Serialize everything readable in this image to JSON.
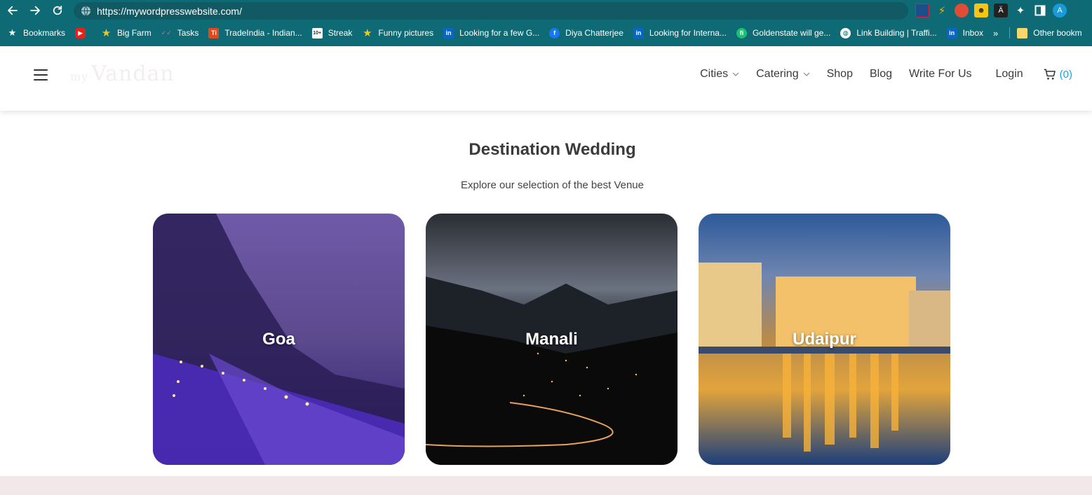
{
  "browser": {
    "url": "https://mywordpresswebsite.com/",
    "bookmarks": [
      {
        "label": "Bookmarks",
        "icon": "star-icon"
      },
      {
        "label": "",
        "icon": "youtube-icon"
      },
      {
        "label": "Big Farm",
        "icon": "star-icon"
      },
      {
        "label": "Tasks",
        "icon": "tasks-icon"
      },
      {
        "label": "TradeIndia - Indian...",
        "icon": "tradeindia-icon"
      },
      {
        "label": "Streak",
        "icon": "streak-icon"
      },
      {
        "label": "Funny pictures",
        "icon": "star-icon"
      },
      {
        "label": "Looking for a few G...",
        "icon": "linkedin-icon"
      },
      {
        "label": "Diya Chatterjee",
        "icon": "facebook-icon"
      },
      {
        "label": "Looking for Interna...",
        "icon": "linkedin-icon"
      },
      {
        "label": "Goldenstate will ge...",
        "icon": "fiverr-icon"
      },
      {
        "label": "Link Building | Traffi...",
        "icon": "globe-icon"
      },
      {
        "label": "Inbox",
        "icon": "linkedin-icon"
      }
    ],
    "more": "»",
    "other_bookmarks": "Other bookm",
    "profile_initial": "A"
  },
  "site": {
    "logo_small": "my",
    "logo_text": "Vandan",
    "nav": {
      "cities": "Cities",
      "catering": "Catering",
      "shop": "Shop",
      "blog": "Blog",
      "write": "Write For Us",
      "login": "Login",
      "cart_count": "(0)"
    }
  },
  "section": {
    "title": "Destination Wedding",
    "subtitle": "Explore our selection of the best Venue",
    "cards": [
      {
        "label": "Goa"
      },
      {
        "label": "Manali"
      },
      {
        "label": "Udaipur"
      }
    ]
  },
  "colors": {
    "chrome": "#0e6b75",
    "accent": "#1aa4d8",
    "footer": "#f2e8e9"
  }
}
